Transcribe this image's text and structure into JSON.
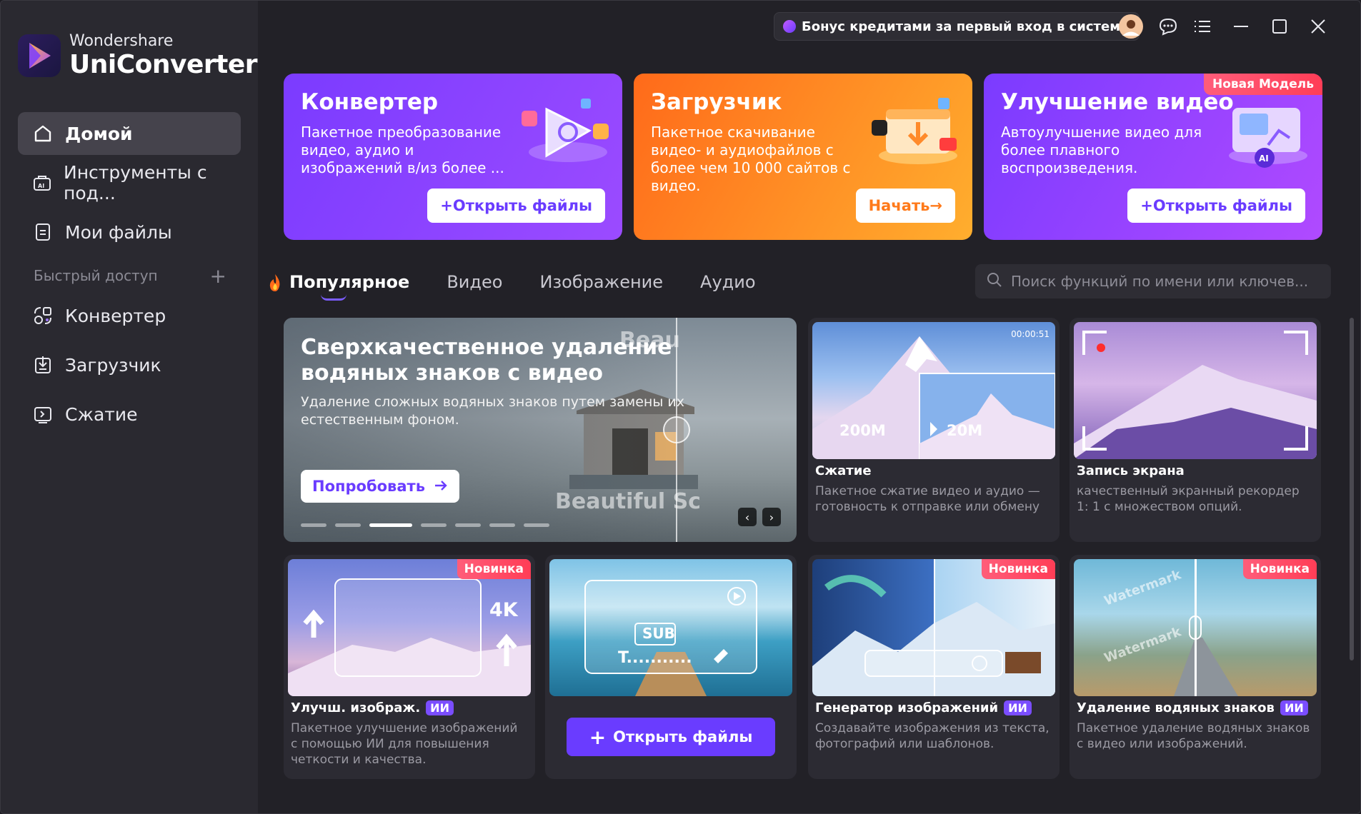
{
  "app": {
    "brand": "Wondershare",
    "product": "UniConverter"
  },
  "sidebar": {
    "items": [
      {
        "label": "Домой",
        "icon": "home-icon"
      },
      {
        "label": "Инструменты с под...",
        "icon": "ai-tools-icon"
      },
      {
        "label": "Мои файлы",
        "icon": "file-icon"
      }
    ],
    "quick_access_label": "Быстрый доступ",
    "quick_access_add": "+",
    "quick_items": [
      {
        "label": "Конвертер",
        "icon": "converter-icon"
      },
      {
        "label": "Загрузчик",
        "icon": "download-icon"
      },
      {
        "label": "Сжатие",
        "icon": "compress-icon"
      }
    ]
  },
  "titlebar": {
    "bonus_text": "Бонус кредитами за первый вход в систему"
  },
  "hero": [
    {
      "title": "Конвертер",
      "desc": "Пакетное преобразование видео, аудио и изображений в/из более ...",
      "button": "+Открыть файлы",
      "color_from": "#7b3bff",
      "color_to": "#9b4bff"
    },
    {
      "title": "Загрузчик",
      "desc": "Пакетное скачивание видео- и аудиофайлов с более чем 10 000 сайтов с видео.",
      "button": "Начать→",
      "color_from": "#ff6a1a",
      "color_to": "#ffae2e"
    },
    {
      "title": "Улучшение видео",
      "desc": "Автоулучшение видео для более плавного воспроизведения.",
      "button": "+Открыть файлы",
      "badge": "Новая Модель",
      "color_from": "#7b3bff",
      "color_to": "#b04aff"
    }
  ],
  "tabs": [
    "Популярное",
    "Видео",
    "Изображение",
    "Аудио"
  ],
  "search": {
    "placeholder": "Поиск функций по имени или ключев..."
  },
  "banner": {
    "title": "Сверхкачественное удаление водяных знаков с видео",
    "desc": "Удаление сложных водяных знаков путем замены их естественным фоном.",
    "button": "Попробовать",
    "watermark_top": "Beau",
    "watermark_bottom": "Beautiful Sc"
  },
  "cards": [
    {
      "title": "Сжатие",
      "desc": "Пакетное сжатие видео и аудио — готовность к отправке или обмену",
      "time": "00:00:51",
      "size_from": "200M",
      "size_to": "20M"
    },
    {
      "title": "Запись экрана",
      "desc": "качественный экранный рекордер 1: 1 с множеством опций."
    },
    {
      "title": "Улучш. изображ.",
      "ai": "ИИ",
      "badge": "Новинка",
      "desc": "Пакетное улучшение изображений с помощью ИИ для повышения четкости и качества.",
      "res": "4K"
    },
    {
      "title": "",
      "button": "Открыть файлы",
      "sub": "SUB",
      "sub_text": "T..........."
    },
    {
      "title": "Генератор изображений",
      "ai": "ИИ",
      "badge": "Новинка",
      "desc": "Создавайте изображения из текста, фотографий или шаблонов."
    },
    {
      "title": "Удаление водяных знаков",
      "ai": "ИИ",
      "badge": "Новинка",
      "desc": "Пакетное удаление водяных знаков с видео или изображений.",
      "wm": "Watermark"
    }
  ]
}
